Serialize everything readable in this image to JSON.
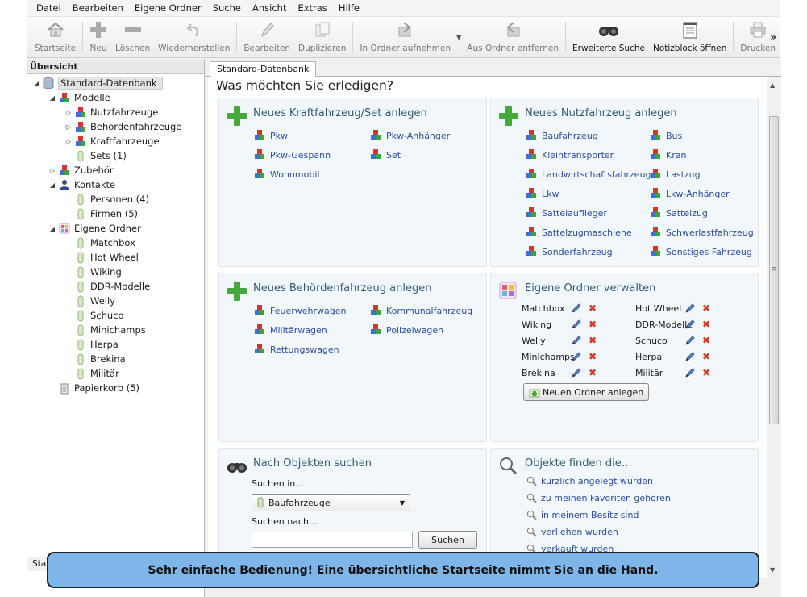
{
  "menu": [
    "Datei",
    "Bearbeiten",
    "Eigene Ordner",
    "Suche",
    "Ansicht",
    "Extras",
    "Hilfe"
  ],
  "toolbar": {
    "startseite": "Startseite",
    "neu": "Neu",
    "loeschen": "Löschen",
    "wiederherstellen": "Wiederherstellen",
    "bearbeiten": "Bearbeiten",
    "duplizieren": "Duplizieren",
    "in_ordner": "In Ordner aufnehmen",
    "aus_ordner": "Aus Ordner entfernen",
    "erweiterte_suche": "Erweiterte Suche",
    "notizblock": "Notizblock öffnen",
    "drucken": "Drucken",
    "more": "»"
  },
  "sidebar": {
    "header": "Übersicht",
    "tree": [
      "Standard-Datenbank",
      "Modelle",
      "Nutzfahrzeuge",
      "Behördenfahrzeuge",
      "Kraftfahrzeuge",
      "Sets (1)",
      "Zubehör",
      "Kontakte",
      "Personen (4)",
      "Firmen (5)",
      "Eigene Ordner",
      "Matchbox",
      "Hot Wheel",
      "Wiking",
      "DDR-Modelle",
      "Welly",
      "Schuco",
      "Minichamps",
      "Herpa",
      "Brekina",
      "Militär",
      "Papierkorb (5)"
    ],
    "bottom_tab": "Sta"
  },
  "tab": "Standard-Datenbank",
  "page_title": "Was möchten Sie erledigen?",
  "kfz": {
    "title": "Neues Kraftfahrzeug/Set anlegen",
    "links": [
      "Pkw",
      "Pkw-Anhänger",
      "Pkw-Gespann",
      "Set",
      "Wohnmobil"
    ]
  },
  "nfz": {
    "title": "Neues Nutzfahrzeug anlegen",
    "links": [
      "Baufahrzeug",
      "Bus",
      "Kleintransporter",
      "Kran",
      "Landwirtschaftsfahrzeug",
      "Lastzug",
      "Lkw",
      "Lkw-Anhänger",
      "Sattelauflieger",
      "Sattelzug",
      "Sattelzugmaschiene",
      "Schwerlastfahrzeug",
      "Sonderfahrzeug",
      "Sonstiges Fahrzeug"
    ]
  },
  "bfz": {
    "title": "Neues Behördenfahrzeug anlegen",
    "links": [
      "Feuerwehrwagen",
      "Kommunalfahrzeug",
      "Militärwagen",
      "Polizeiwagen",
      "Rettungswagen"
    ]
  },
  "folders": {
    "title": "Eigene Ordner verwalten",
    "items": [
      "Matchbox",
      "Hot Wheel",
      "Wiking",
      "DDR-Modelle",
      "Welly",
      "Schuco",
      "Minichamps",
      "Herpa",
      "Brekina",
      "Militär"
    ],
    "new_button": "Neuen Ordner anlegen"
  },
  "search": {
    "title": "Nach Objekten suchen",
    "in_label": "Suchen in…",
    "in_value": "Baufahrzeuge",
    "for_label": "Suchen nach…",
    "button": "Suchen"
  },
  "find": {
    "title": "Objekte finden die…",
    "links": [
      "kürzlich angelegt wurden",
      "zu meinen Favoriten gehören",
      "in meinem Besitz sind",
      "verliehen wurden",
      "verkauft wurden"
    ]
  },
  "banner": "Sehr einfache Bedienung! Eine übersichtliche Startseite nimmt Sie an die Hand.",
  "colors": {
    "panel_bg": "#f1f7fb",
    "link": "#2b4d9f",
    "heading": "#2d5a70",
    "banner": "#7eb6e9"
  }
}
